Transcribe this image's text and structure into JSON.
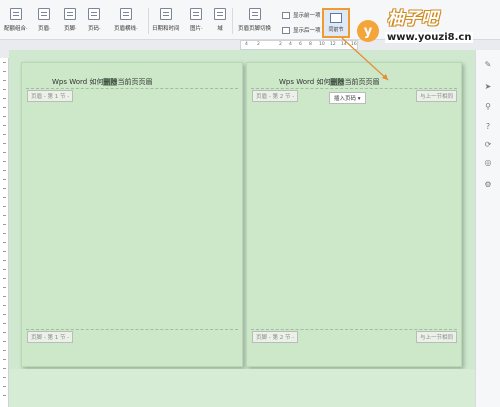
{
  "toolbar": {
    "buttons": [
      {
        "label": "配额组合·"
      },
      {
        "label": "页眉·"
      },
      {
        "label": "页脚·"
      },
      {
        "label": "页码·"
      },
      {
        "label": "页眉横线·"
      },
      {
        "label": "日期和时间"
      },
      {
        "label": "图片·"
      },
      {
        "label": "域"
      },
      {
        "label": "页眉页脚切换"
      }
    ],
    "show_prev": "显示前一项",
    "show_next": "显示后一项",
    "highlight_label": "同前节"
  },
  "watermark": {
    "badge": "y",
    "brand": "柚子吧",
    "url": "www.youzi8.cn"
  },
  "ruler": {
    "ticks": [
      "4",
      "2",
      "2",
      "4",
      "6",
      "8",
      "10",
      "12",
      "14",
      "16"
    ]
  },
  "pages": {
    "left": {
      "header_prefix": "Wps Word 如何",
      "header_selected": "删除",
      "header_suffix": "当前页页眉",
      "header_tag": "页眉 - 第 1 节 -",
      "footer_tag": "页脚 - 第 1 节 -"
    },
    "right": {
      "header_prefix": "Wps Word 如何",
      "header_selected": "删除",
      "header_suffix": "当前页页眉",
      "header_tag": "页眉 - 第 2 节 -",
      "same_as_prev_header": "与上一节相同",
      "insert_page_num": "插入页码 ▾",
      "footer_tag": "页脚 - 第 2 节 -",
      "same_as_prev_footer": "与上一节相同"
    }
  },
  "colors": {
    "page_bg": "#cce8c8",
    "highlight": "#f19a30",
    "watermark_orange": "#f3a53a"
  }
}
